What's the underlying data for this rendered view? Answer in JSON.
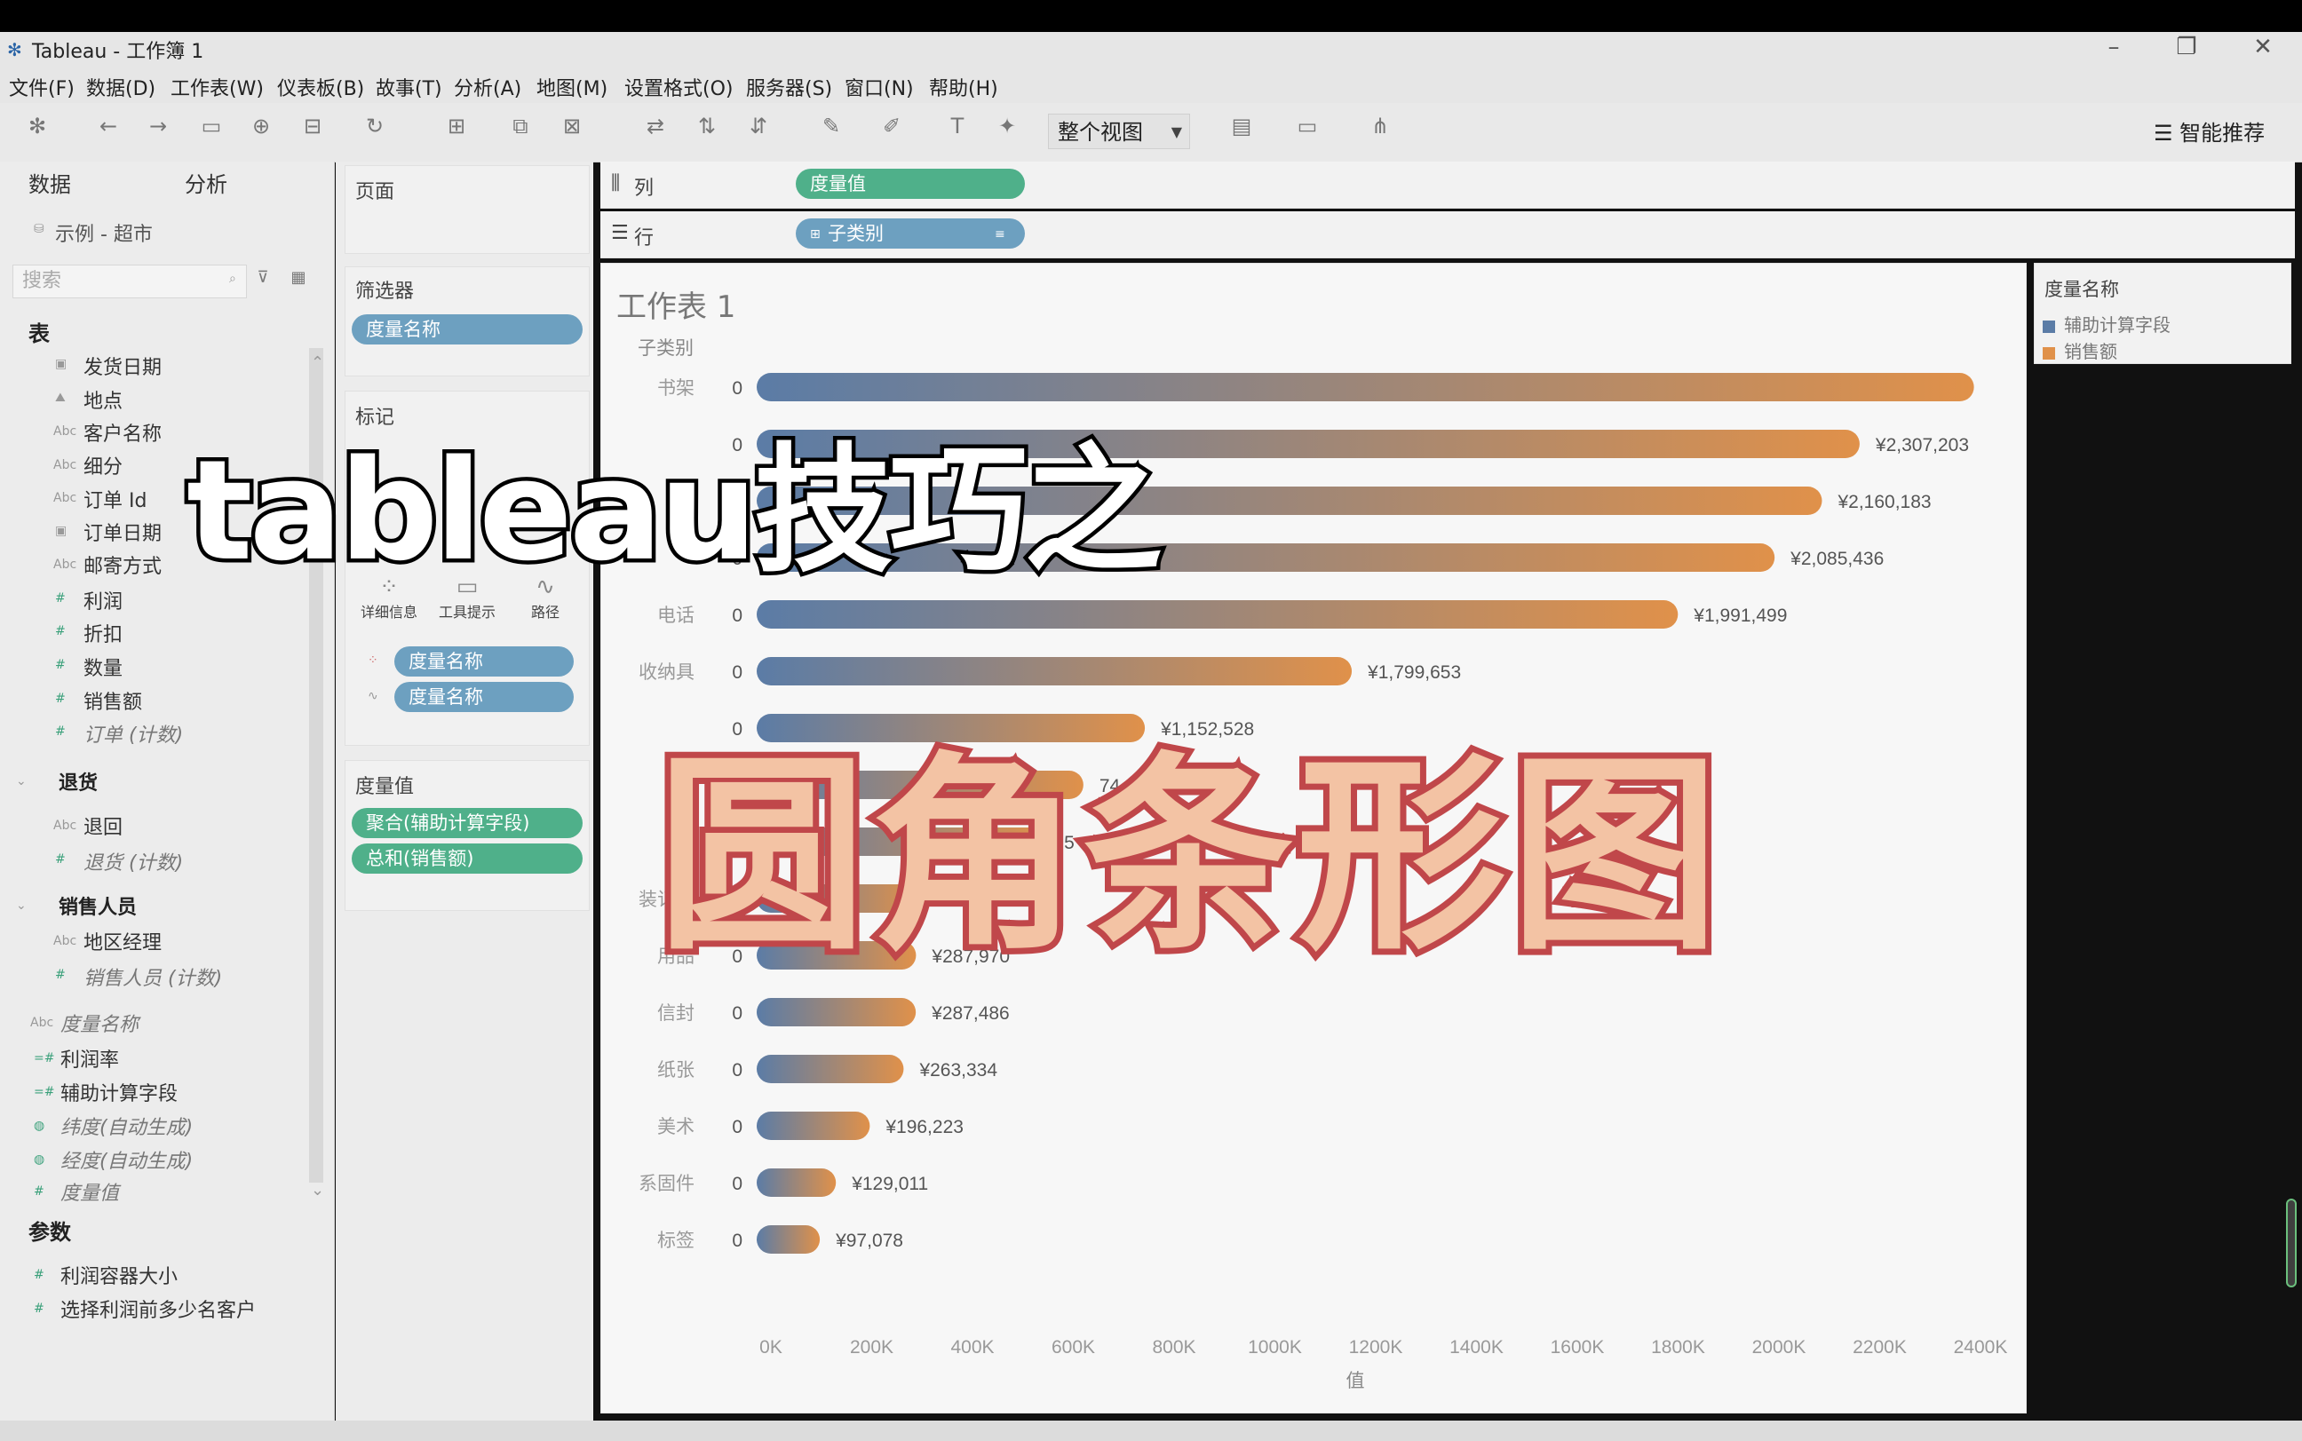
{
  "window": {
    "title": "Tableau - 工作簿 1"
  },
  "menu": [
    "文件(F)",
    "数据(D)",
    "工作表(W)",
    "仪表板(B)",
    "故事(T)",
    "分析(A)",
    "地图(M)",
    "设置格式(O)",
    "服务器(S)",
    "窗口(N)",
    "帮助(H)"
  ],
  "toolbar": {
    "view_select": "整个视图",
    "smart_label": "智能推荐"
  },
  "left": {
    "tab_data": "数据",
    "tab_analysis": "分析",
    "datasource": "示例 - 超市",
    "search_placeholder": "搜索",
    "tables_head": "表",
    "fields": [
      "发货日期",
      "地点",
      "客户名称",
      "细分",
      "订单 Id",
      "订单日期",
      "邮寄方式",
      "利润",
      "折扣",
      "数量",
      "销售额",
      "订单 (计数)"
    ],
    "returns_head": "退货",
    "returns_fields": [
      "退回",
      "退货 (计数)"
    ],
    "sales_head": "销售人员",
    "sales_fields": [
      "地区经理",
      "销售人员 (计数)"
    ],
    "calc_fields": [
      "度量名称",
      "利润率",
      "辅助计算字段",
      "纬度(自动生成)",
      "经度(自动生成)",
      "度量值"
    ],
    "params_head": "参数",
    "params": [
      "利润容器大小",
      "选择利润前多少名客户"
    ]
  },
  "shelves": {
    "pages": "页面",
    "filters": "筛选器",
    "filter_pill": "度量名称",
    "marks": "标记",
    "mark_buttons": [
      "详细信息",
      "工具提示",
      "路径"
    ],
    "mark_pills": [
      "度量名称",
      "度量名称"
    ],
    "measure_values": "度量值",
    "measure_pills": [
      "聚合(辅助计算字段)",
      "总和(销售额)"
    ],
    "columns_label": "列",
    "columns_pill": "度量值",
    "rows_label": "行",
    "rows_pill": "子类别"
  },
  "sheet": {
    "title": "工作表 1",
    "axis_field": "子类别"
  },
  "legend": {
    "title": "度量名称",
    "items": [
      {
        "label": "辅助计算字段",
        "color": "#5b7ca6"
      },
      {
        "label": "销售额",
        "color": "#e0914a"
      }
    ]
  },
  "overlay": {
    "line1": "tableau技巧之",
    "line2": "圆角条形图"
  },
  "chart_data": {
    "type": "bar",
    "orientation": "horizontal",
    "categories": [
      "书架",
      "",
      "",
      "",
      "电话",
      "收纳具",
      "",
      "",
      "",
      "装订机",
      "用品",
      "信封",
      "纸张",
      "美术",
      "系固件",
      "标签"
    ],
    "series": [
      {
        "name": "辅助计算字段",
        "values": [
          0,
          0,
          0,
          0,
          0,
          0,
          0,
          0,
          0,
          0,
          0,
          0,
          0,
          0,
          0,
          0
        ]
      },
      {
        "name": "销售额",
        "values": [
          2387000,
          2160183,
          2085436,
          1991499,
          1799653,
          1152528,
          742000,
          620000,
          550000,
          291777,
          287970,
          287486,
          263334,
          196223,
          129011,
          97078
        ]
      }
    ],
    "value_labels": [
      "",
      "¥2,307,203",
      "¥2,160,183",
      "¥2,085,436",
      "¥1,991,499",
      "¥1,799,653",
      "¥1,152,528",
      "74",
      "5",
      "¥291,777",
      "¥287,970",
      "¥287,486",
      "¥263,334",
      "¥196,223",
      "¥129,011",
      "¥97,078"
    ],
    "zero_label": "0",
    "x_ticks": [
      "0K",
      "200K",
      "400K",
      "600K",
      "800K",
      "1000K",
      "1200K",
      "1400K",
      "1600K",
      "1800K",
      "2000K",
      "2200K",
      "2400K"
    ],
    "xlabel": "值",
    "ylabel": "子类别",
    "xlim": [
      0,
      2400000
    ],
    "gradient": [
      "#5b7ca6",
      "#e0914a"
    ]
  }
}
